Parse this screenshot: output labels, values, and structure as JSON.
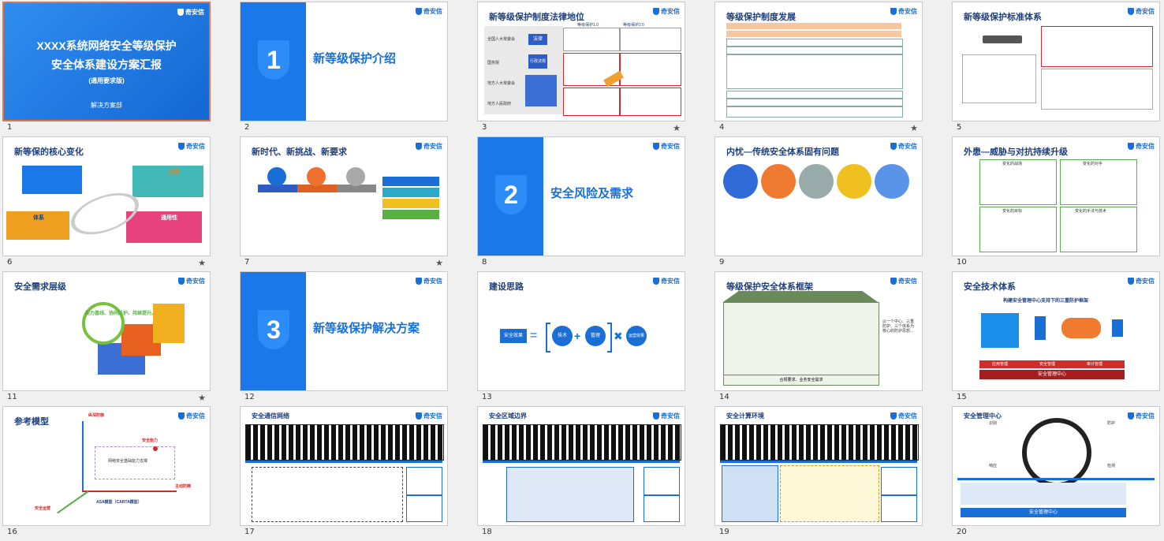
{
  "logo_text": "奇安信",
  "slides": [
    {
      "number": "1",
      "title": "XXXX系统网络安全等级保护",
      "title2": "安全体系建设方案汇报",
      "subtitle": "(通用要求版)",
      "org": "解决方案部"
    },
    {
      "number": "2",
      "section": "1",
      "title": "新等级保护介绍"
    },
    {
      "number": "3",
      "title": "新等级保护制度法律地位",
      "labels": [
        "等级保护1.0",
        "等级保护2.0",
        "全国人大常委会",
        "法律",
        "国务院",
        "行政法规",
        "地方人大常委会",
        "地方人民政府"
      ]
    },
    {
      "number": "4",
      "title": "等级保护制度发展"
    },
    {
      "number": "5",
      "title": "新等级保护标准体系"
    },
    {
      "number": "6",
      "title": "新等保的核心变化",
      "callouts": [
        "外延",
        "体系",
        "通用性"
      ]
    },
    {
      "number": "7",
      "title": "新时代、新挑战、新要求"
    },
    {
      "number": "8",
      "section": "2",
      "title": "安全风险及需求"
    },
    {
      "number": "9",
      "title": "内忧—传统安全体系固有问题"
    },
    {
      "number": "10",
      "title": "外患—威胁与对抗持续升级",
      "panels": [
        "变化的战场",
        "变化的对手",
        "变化的目标",
        "变化的手法与技术"
      ]
    },
    {
      "number": "11",
      "title": "安全需求层级",
      "tagline": "能力基线、协同防护、持续提升。"
    },
    {
      "number": "12",
      "section": "3",
      "title": "新等级保护解决方案"
    },
    {
      "number": "13",
      "title": "建设思路",
      "formula": [
        "安全效果",
        "技术",
        "管理",
        "运营效果"
      ]
    },
    {
      "number": "14",
      "title": "等级保护安全体系框架",
      "footer": "合规要求、业务安全需求",
      "side_text": "以一个中心、三重防护、三个体系为核心的防护思想..."
    },
    {
      "number": "15",
      "title": "安全技术体系",
      "subtitle": "构建安全管理中心支持下的三重防护框架",
      "bottom": [
        "应用管理",
        "安全管理",
        "审计管理"
      ],
      "center": "安全管理中心"
    },
    {
      "number": "16",
      "title": "参考模型",
      "labels": [
        "纵深防御",
        "安全能力",
        "主动防御",
        "安全运营",
        "ASA模型（CARTA模型）",
        "网络安全基础能力支撑"
      ]
    },
    {
      "number": "17",
      "title": "安全通信网络"
    },
    {
      "number": "18",
      "title": "安全区域边界"
    },
    {
      "number": "19",
      "title": "安全计算环境"
    },
    {
      "number": "20",
      "title": "安全管理中心",
      "ring": [
        "识别",
        "防护",
        "检测",
        "响应"
      ],
      "bar": "安全管理中心"
    }
  ],
  "starred": [
    "3",
    "4",
    "6",
    "7",
    "11"
  ]
}
